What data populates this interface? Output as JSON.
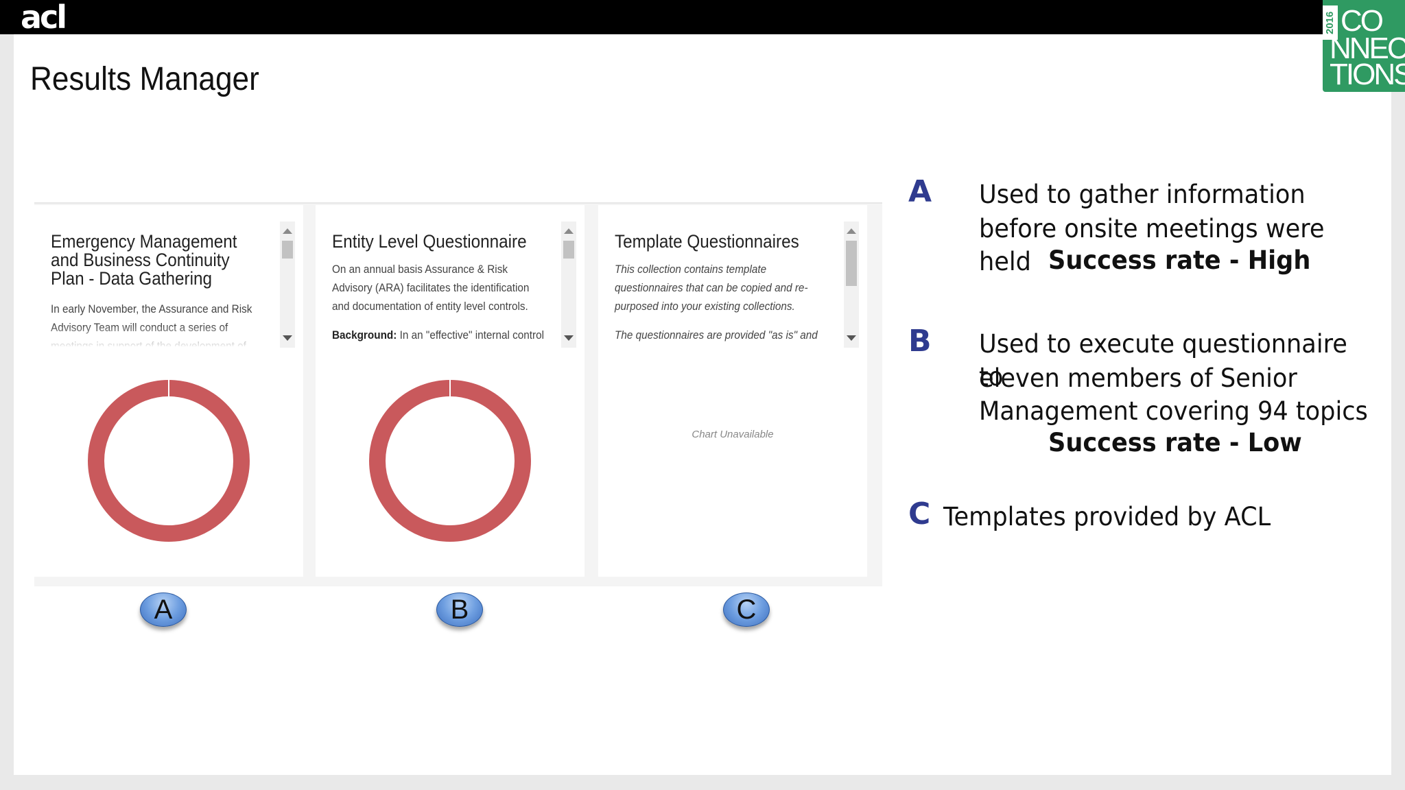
{
  "header": {
    "logo_text": "acl"
  },
  "brand": {
    "year": "2016",
    "line1": "CO",
    "line2": "NNEC",
    "line3": "TIONS",
    "color": "#2f9a62"
  },
  "page_title": "Results Manager",
  "cards": [
    {
      "title": "Emergency Management and Business Continuity Plan - Data Gathering",
      "description": "In early November, the Assurance and Risk Advisory Team will conduct a series of meetings in support of the development of",
      "chart_color": "#c9595c",
      "marker": "A"
    },
    {
      "title": "Entity Level Questionnaire",
      "description": "On an annual basis Assurance & Risk Advisory (ARA) facilitates the identification and documentation of entity level controls.",
      "background_label": "Background:",
      "background_text": " In an \"effective\" internal control",
      "chart_color": "#c9595c",
      "marker": "B"
    },
    {
      "title": "Template Questionnaires",
      "description": "This collection contains template questionnaires that can be copied and re-purposed into your existing collections.",
      "description2": "The questionnaires are provided \"as is\" and ACL",
      "chart_text": "Chart Unavailable",
      "marker": "C"
    }
  ],
  "legend": [
    {
      "letter": "A",
      "text_line1": "Used to gather information",
      "text_line2": "before onsite meetings were held",
      "rate": "Success rate - High"
    },
    {
      "letter": "B",
      "text_line1": "Used to execute questionnaire to",
      "text_line2": "eleven members of Senior",
      "text_line3": "Management covering 94 topics",
      "rate": "Success rate - Low"
    },
    {
      "letter": "C",
      "text_line1": "Templates provided by ACL"
    }
  ]
}
